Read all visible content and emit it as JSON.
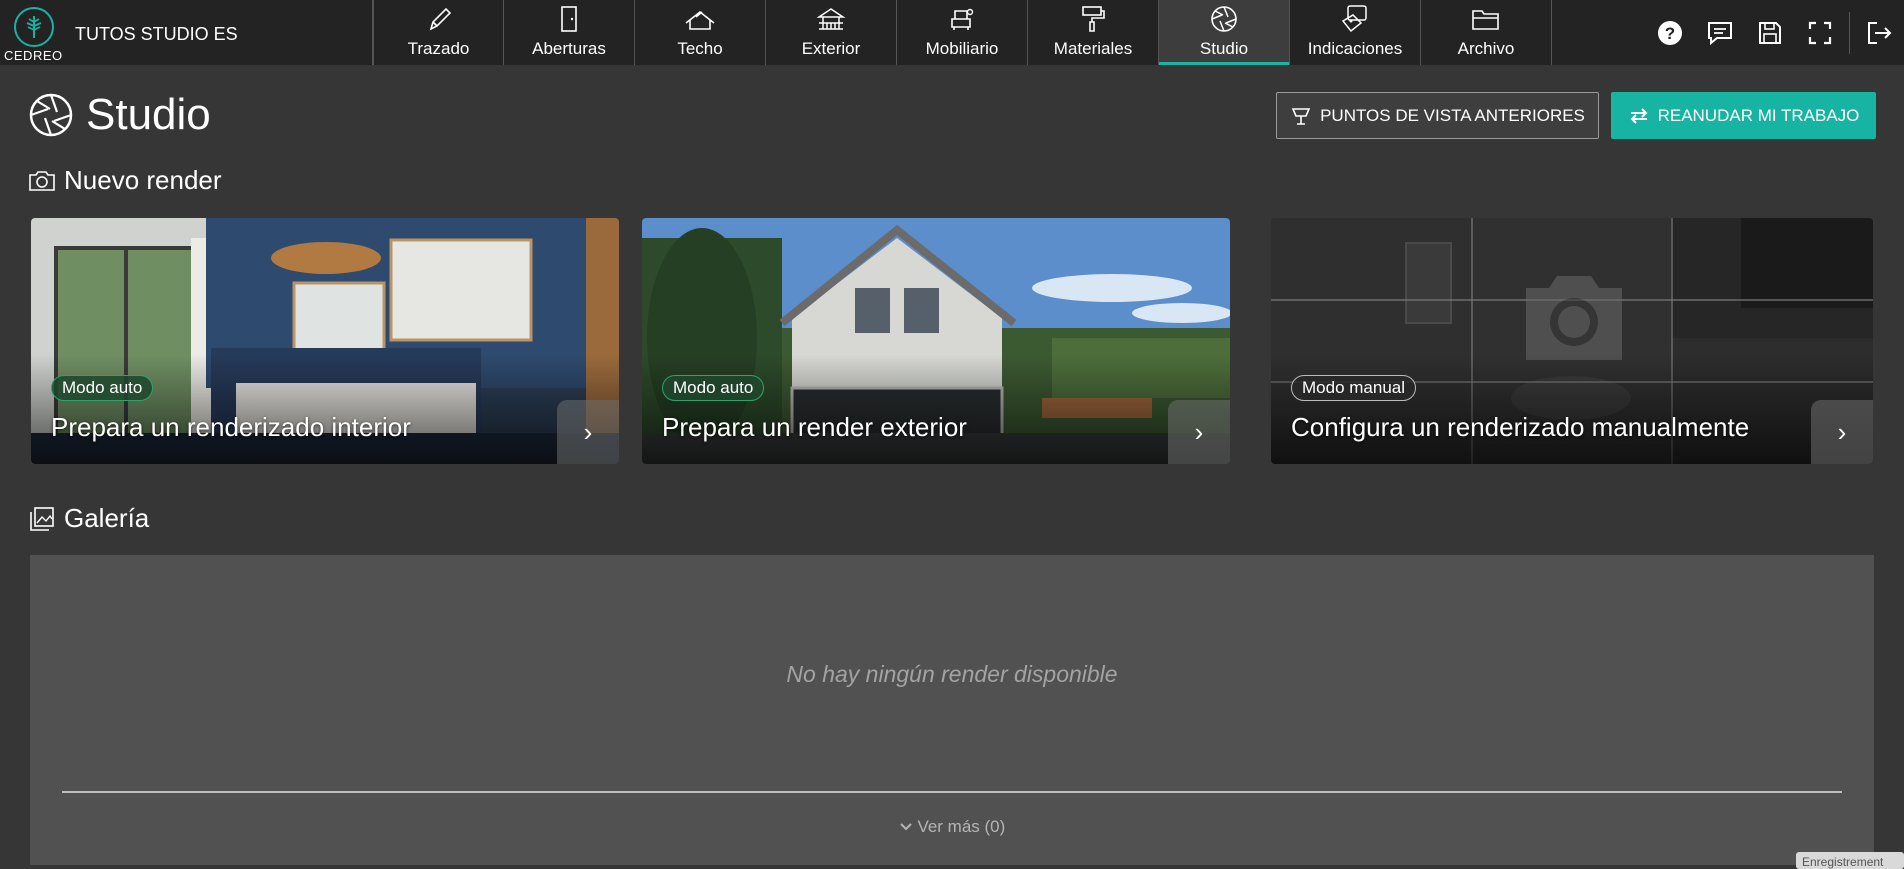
{
  "app": {
    "logo_text": "CEDREO",
    "project_name": "TUTOS STUDIO ES",
    "accent_color": "#17b3a3"
  },
  "nav": {
    "tabs": [
      {
        "label": "Trazado",
        "icon": "pencil-icon"
      },
      {
        "label": "Aberturas",
        "icon": "door-icon"
      },
      {
        "label": "Techo",
        "icon": "roof-icon"
      },
      {
        "label": "Exterior",
        "icon": "terrace-icon"
      },
      {
        "label": "Mobiliario",
        "icon": "armchair-icon"
      },
      {
        "label": "Materiales",
        "icon": "paint-roller-icon"
      },
      {
        "label": "Studio",
        "icon": "aperture-icon",
        "active": true
      },
      {
        "label": "Indicaciones",
        "icon": "tags-icon"
      },
      {
        "label": "Archivo",
        "icon": "folder-icon"
      }
    ]
  },
  "tools": [
    "help-icon",
    "comment-icon",
    "save-icon",
    "fullscreen-icon",
    "logout-icon"
  ],
  "header": {
    "title": "Studio",
    "prev_views_label": "PUNTOS DE VISTA ANTERIORES",
    "resume_label": "REANUDAR MI TRABAJO"
  },
  "new_render": {
    "section_title": "Nuevo render",
    "cards": [
      {
        "badge": "Modo auto",
        "title": "Prepara un renderizado interior"
      },
      {
        "badge": "Modo auto",
        "title": "Prepara un render exterior"
      },
      {
        "badge": "Modo manual",
        "title": "Configura un renderizado manualmente"
      }
    ]
  },
  "gallery": {
    "section_title": "Galería",
    "empty_text": "No hay ningún render disponible",
    "more_label": "Ver más (0)"
  },
  "toast": {
    "text": "Enregistrement"
  }
}
